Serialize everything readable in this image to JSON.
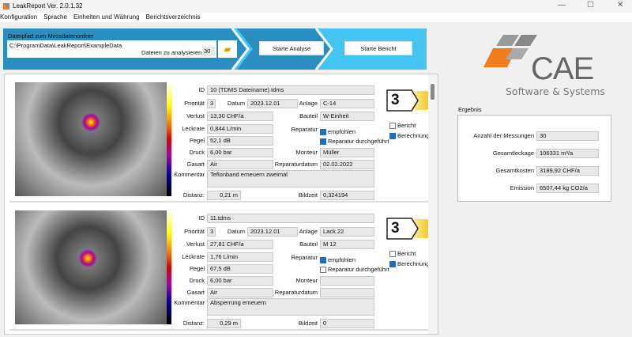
{
  "window": {
    "title": "LeakReport Ver. 2.0.1.32"
  },
  "menu": [
    "Konfiguration",
    "Sprache",
    "Einheiten und Währung",
    "Berichtsverzeichnis"
  ],
  "header": {
    "path_label": "Dateipfad zum Messdatenordner",
    "path_value": "C:\\ProgramData\\LeakReport\\ExampleData",
    "files_label": "Dateien zu analysieren",
    "files_value": "30",
    "analyse_button": "Starte Analyse",
    "report_button": "Starte Bericht"
  },
  "labels": {
    "id": "ID",
    "prio": "Priorität",
    "datum": "Datum",
    "anlage": "Anlage",
    "verlust": "Verlust",
    "bauteil": "Bauteil",
    "leckrate": "Leckrate",
    "reparatur": "Reparatur",
    "empfohlen": "empfohlen",
    "durchgefuehrt": "Reparatur durchgeführt",
    "pegel": "Pegel",
    "druck": "Druck",
    "monteur": "Monteur",
    "gasart": "Gasart",
    "reparaturdatum": "Reparaturdatum",
    "kommentar": "Kommentar",
    "distanz": "Distanz:",
    "bildzeit": "Bildzeit",
    "bericht": "Bericht",
    "berechnung": "Berechnung"
  },
  "cards": [
    {
      "id": "10 (TDMS Dateiname).tdms",
      "prio": "3",
      "datum": "2023.12.01",
      "anlage": "C-14",
      "verlust": "13,30 CHF/a",
      "bauteil": "W-Einheit",
      "leckrate": "0,844 L/min",
      "pegel": "52,1 dB",
      "druck": "6,00 bar",
      "monteur": "Müller",
      "gasart": "Air",
      "reparaturdatum": "02.02.2022",
      "kommentar": "Teflonband erneuern zweimal",
      "distanz": "0,21 m",
      "bildzeit": "0,324194",
      "badge": "3",
      "empfohlen": true,
      "durchgefuehrt": true,
      "bericht": false,
      "berechnung": true
    },
    {
      "id": "11.tdms",
      "prio": "3",
      "datum": "2023.12.01",
      "anlage": "Lack 22",
      "verlust": "27,81 CHF/a",
      "bauteil": "M 12",
      "leckrate": "1,76 L/min",
      "pegel": "67,5 dB",
      "druck": "6,00 bar",
      "monteur": "",
      "gasart": "Air",
      "reparaturdatum": "",
      "kommentar": "Absperrung erneuern",
      "distanz": "0,29 m",
      "bildzeit": "0",
      "badge": "3",
      "empfohlen": true,
      "durchgefuehrt": false,
      "bericht": false,
      "berechnung": true
    }
  ],
  "logo": {
    "brand": "CAE",
    "tagline": "Software & Systems"
  },
  "result": {
    "title": "Ergebnis",
    "rows": [
      {
        "label": "Anzahl der Messungen",
        "value": "30"
      },
      {
        "label": "Gesamtleckage",
        "value": "106331 m³/a"
      },
      {
        "label": "Gesamtkosten",
        "value": "3189,92 CHF/a"
      },
      {
        "label": "Emission",
        "value": "6507,44 kg CO2/a"
      }
    ]
  },
  "colors": {
    "band_dark": "#2a8fc0",
    "band_light": "#44c4f0",
    "badge": "#f2c400",
    "logo_orange": "#f07d19",
    "logo_gray": "#8a8a8a"
  }
}
